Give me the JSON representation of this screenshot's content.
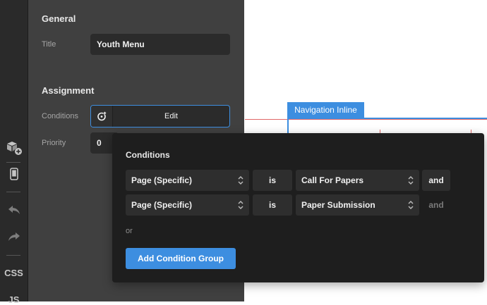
{
  "rail": {
    "items": [
      {
        "icon": "components-add-icon"
      },
      {
        "icon": "mobile-device-icon"
      },
      {
        "icon": "undo-icon"
      },
      {
        "icon": "redo-icon"
      }
    ],
    "css_label": "CSS",
    "js_label": "JS"
  },
  "panel": {
    "general_heading": "General",
    "title_label": "Title",
    "title_value": "Youth Menu",
    "assignment_heading": "Assignment",
    "conditions_label": "Conditions",
    "conditions_edit": "Edit",
    "priority_label": "Priority",
    "priority_value": "0"
  },
  "canvas": {
    "element_tag": "Navigation Inline"
  },
  "conditions_popup": {
    "title": "Conditions",
    "rows": [
      {
        "type": "Page (Specific)",
        "operator": "is",
        "value": "Call For Papers",
        "conjunction": "and"
      },
      {
        "type": "Page (Specific)",
        "operator": "is",
        "value": "Paper Submission",
        "conjunction": "and"
      }
    ],
    "or_label": "or",
    "add_group_label": "Add Condition Group"
  },
  "colors": {
    "accent": "#3d8ee0",
    "panel_bg": "#404040",
    "popup_bg": "#1e1e1e",
    "guide_red": "#e06767"
  }
}
